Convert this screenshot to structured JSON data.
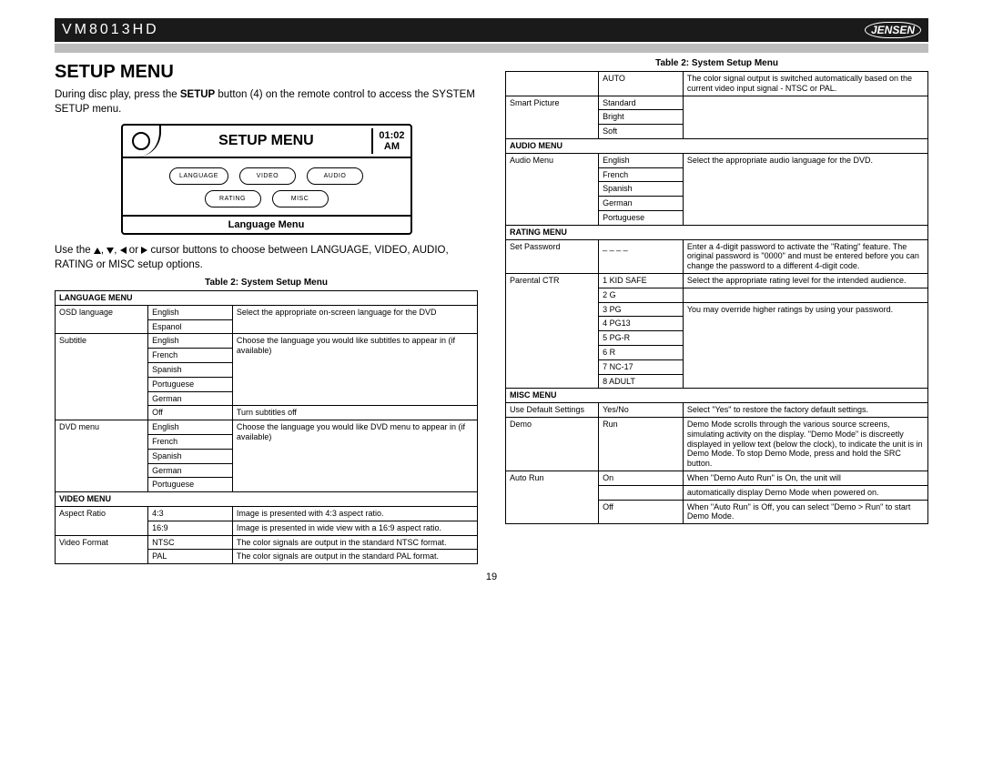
{
  "header": {
    "model": "VM8013HD",
    "brand": "JENSEN"
  },
  "title": "SETUP MENU",
  "intro_pre": "During disc play, press the ",
  "intro_bold": "SETUP",
  "intro_post": " button (4) on the remote control to access the SYSTEM SETUP menu.",
  "device": {
    "screen_title": "SETUP MENU",
    "clock_time": "01:02",
    "clock_ampm": "AM",
    "buttons": [
      "LANGUAGE",
      "VIDEO",
      "AUDIO",
      "RATING",
      "MISC"
    ],
    "footer": "Language Menu"
  },
  "cursor_text_pre": "Use the ",
  "cursor_text_post": " cursor buttons to choose between LANGUAGE, VIDEO, AUDIO, RATING or MISC setup options.",
  "table_caption": "Table 2: System Setup Menu",
  "left_rows": [
    {
      "c1": "LANGUAGE MENU",
      "span": 3,
      "section": true
    },
    {
      "c1": "OSD language",
      "c2": "English",
      "c3": "Select the appropriate on-screen language for the DVD",
      "c1r": 2,
      "c3r": 2
    },
    {
      "c2": "Espanol"
    },
    {
      "c1": "Subtitle",
      "c2": "English",
      "c3": "Choose the language you would like subtitles to appear in (if available)",
      "c1r": 6,
      "c3r": 5
    },
    {
      "c2": "French"
    },
    {
      "c2": "Spanish"
    },
    {
      "c2": "Portuguese"
    },
    {
      "c2": "German"
    },
    {
      "c2": "Off",
      "c3": "Turn subtitles off"
    },
    {
      "c1": "DVD menu",
      "c2": "English",
      "c3": "Choose the language you would like DVD menu to appear in (if available)",
      "c1r": 5,
      "c3r": 5
    },
    {
      "c2": "French"
    },
    {
      "c2": "Spanish"
    },
    {
      "c2": "German"
    },
    {
      "c2": "Portuguese"
    },
    {
      "c1": "VIDEO MENU",
      "span": 3,
      "section": true
    },
    {
      "c1": "Aspect Ratio",
      "c2": "4:3",
      "c3": "Image is presented with 4:3 aspect ratio.",
      "c1r": 2
    },
    {
      "c2": "16:9",
      "c3": "Image is presented in wide view with a 16:9 aspect ratio."
    },
    {
      "c1": "Video Format",
      "c2": "NTSC",
      "c3": "The color signals are output in the standard NTSC format.",
      "c1r": 2
    },
    {
      "c2": "PAL",
      "c3": "The color signals are output in the standard PAL format."
    }
  ],
  "right_rows": [
    {
      "c1": "",
      "c2": "AUTO",
      "c3": "The color signal output is switched automatically based on the current video input signal - NTSC or PAL."
    },
    {
      "c1": "Smart Picture",
      "c2": "Standard",
      "c3": "",
      "c1r": 3,
      "c3r": 3
    },
    {
      "c2": "Bright"
    },
    {
      "c2": "Soft"
    },
    {
      "c1": "AUDIO MENU",
      "span": 3,
      "section": true
    },
    {
      "c1": "Audio Menu",
      "c2": "English",
      "c3": "Select the appropriate audio language for the DVD.",
      "c1r": 5,
      "c3r": 5
    },
    {
      "c2": "French"
    },
    {
      "c2": "Spanish"
    },
    {
      "c2": "German"
    },
    {
      "c2": "Portuguese"
    },
    {
      "c1": "RATING MENU",
      "span": 3,
      "section": true
    },
    {
      "c1": "Set Password",
      "c2": "_ _ _ _",
      "c3": "Enter a 4-digit password to activate the \"Rating\" feature. The original password is \"0000\" and must be entered before you can change the password to a different 4-digit code."
    },
    {
      "c1": "Parental CTR",
      "c2": "1 KID SAFE",
      "c3": "Select the appropriate rating level for the intended audience.",
      "c1r": 8,
      "c3t": "top"
    },
    {
      "c2": "2 G",
      "c3": ""
    },
    {
      "c2": "3 PG",
      "c3": "You may override higher ratings by using your password.",
      "c3r": 6
    },
    {
      "c2": "4 PG13"
    },
    {
      "c2": "5 PG-R"
    },
    {
      "c2": "6 R"
    },
    {
      "c2": "7 NC-17"
    },
    {
      "c2": "8 ADULT"
    },
    {
      "c1": "MISC MENU",
      "span": 3,
      "section": true
    },
    {
      "c1": "Use Default Settings",
      "c2": "Yes/No",
      "c3": "Select \"Yes\" to restore the factory default settings."
    },
    {
      "c1": "Demo",
      "c2": "Run",
      "c3": "Demo Mode scrolls through the various source screens, simulating activity on the display. \"Demo Mode\" is discreetly displayed in yellow text (below the clock), to indicate the unit is in Demo Mode. To stop Demo Mode, press and hold the SRC button."
    },
    {
      "c1": "Auto Run",
      "c2": "On",
      "c3": "When \"Demo Auto Run\" is On, the unit will",
      "c1r": 3
    },
    {
      "c2": "",
      "c3": "automatically display Demo Mode when powered on."
    },
    {
      "c2": "Off",
      "c3": "When \"Auto Run\" is Off, you can select \"Demo > Run\" to start Demo Mode."
    }
  ],
  "pagenum": "19"
}
